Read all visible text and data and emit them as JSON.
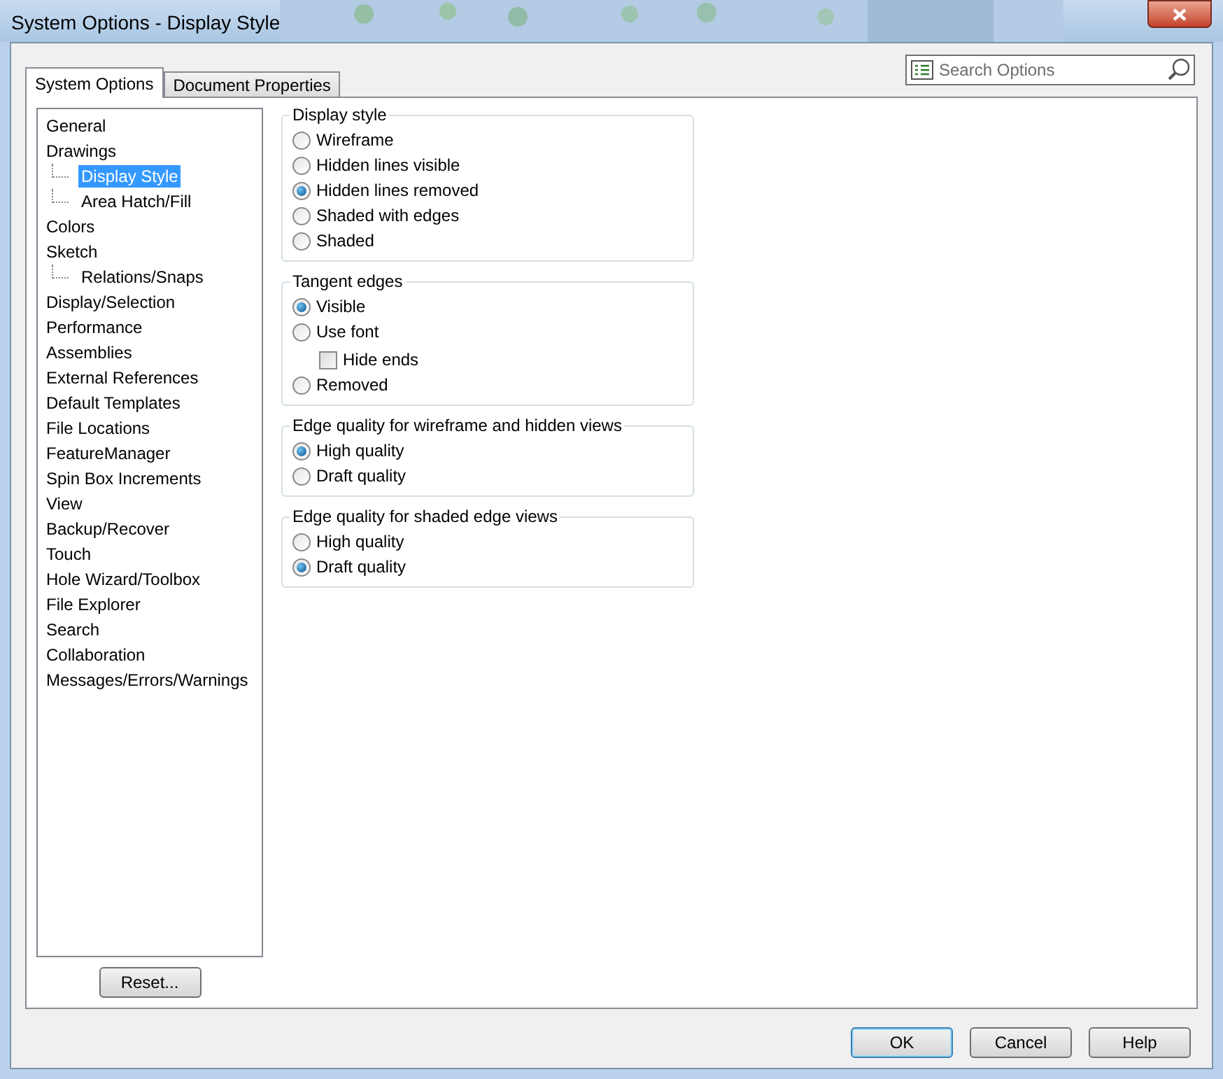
{
  "window": {
    "title": "System Options - Display Style"
  },
  "tabs": [
    {
      "label": "System Options",
      "selected": true
    },
    {
      "label": "Document Properties",
      "selected": false
    }
  ],
  "search": {
    "placeholder": "Search Options"
  },
  "tree": [
    {
      "label": "General",
      "selected": false
    },
    {
      "label": "Drawings",
      "selected": false,
      "children": [
        {
          "label": "Display Style",
          "selected": true
        },
        {
          "label": "Area Hatch/Fill",
          "selected": false
        }
      ]
    },
    {
      "label": "Colors",
      "selected": false
    },
    {
      "label": "Sketch",
      "selected": false,
      "children": [
        {
          "label": "Relations/Snaps",
          "selected": false
        }
      ]
    },
    {
      "label": "Display/Selection",
      "selected": false
    },
    {
      "label": "Performance",
      "selected": false
    },
    {
      "label": "Assemblies",
      "selected": false
    },
    {
      "label": "External References",
      "selected": false
    },
    {
      "label": "Default Templates",
      "selected": false
    },
    {
      "label": "File Locations",
      "selected": false
    },
    {
      "label": "FeatureManager",
      "selected": false
    },
    {
      "label": "Spin Box Increments",
      "selected": false
    },
    {
      "label": "View",
      "selected": false
    },
    {
      "label": "Backup/Recover",
      "selected": false
    },
    {
      "label": "Touch",
      "selected": false
    },
    {
      "label": "Hole Wizard/Toolbox",
      "selected": false
    },
    {
      "label": "File Explorer",
      "selected": false
    },
    {
      "label": "Search",
      "selected": false
    },
    {
      "label": "Collaboration",
      "selected": false
    },
    {
      "label": "Messages/Errors/Warnings",
      "selected": false
    }
  ],
  "reset_button": "Reset...",
  "groups": [
    {
      "title": "Display style",
      "options": [
        {
          "kind": "radio",
          "label": "Wireframe",
          "selected": false
        },
        {
          "kind": "radio",
          "label": "Hidden lines visible",
          "selected": false
        },
        {
          "kind": "radio",
          "label": "Hidden lines removed",
          "selected": true
        },
        {
          "kind": "radio",
          "label": "Shaded with edges",
          "selected": false
        },
        {
          "kind": "radio",
          "label": "Shaded",
          "selected": false
        }
      ]
    },
    {
      "title": "Tangent edges",
      "options": [
        {
          "kind": "radio",
          "label": "Visible",
          "selected": true
        },
        {
          "kind": "radio",
          "label": "Use font",
          "selected": false,
          "children": [
            {
              "kind": "checkbox",
              "label": "Hide ends",
              "checked": false
            }
          ]
        },
        {
          "kind": "radio",
          "label": "Removed",
          "selected": false
        }
      ]
    },
    {
      "title": "Edge quality for wireframe and hidden views",
      "options": [
        {
          "kind": "radio",
          "label": "High quality",
          "selected": true
        },
        {
          "kind": "radio",
          "label": "Draft quality",
          "selected": false
        }
      ]
    },
    {
      "title": "Edge quality for shaded edge views",
      "options": [
        {
          "kind": "radio",
          "label": "High quality",
          "selected": false
        },
        {
          "kind": "radio",
          "label": "Draft quality",
          "selected": true
        }
      ]
    }
  ],
  "buttons": [
    {
      "label": "OK",
      "kind": "default"
    },
    {
      "label": "Cancel",
      "kind": "normal"
    },
    {
      "label": "Help",
      "kind": "normal"
    }
  ]
}
